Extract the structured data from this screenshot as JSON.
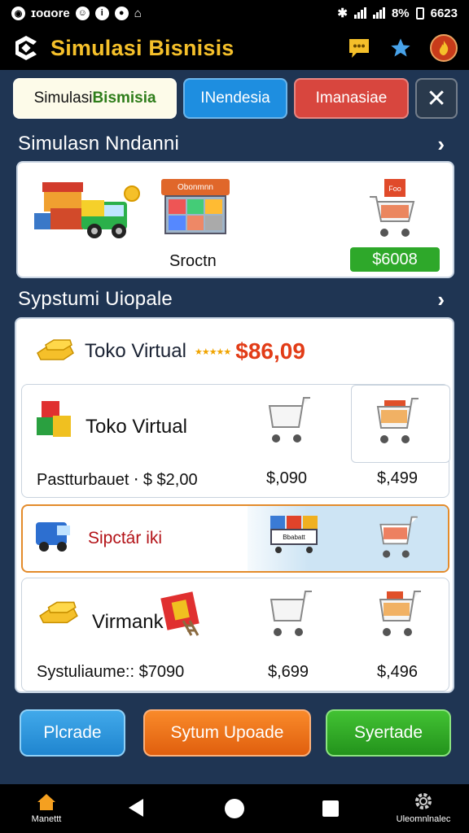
{
  "status_bar": {
    "carrier": "ɪoɑore",
    "battery": "8%",
    "time": "6623"
  },
  "app": {
    "title": "Simulasi Bisnisis"
  },
  "tabs": [
    {
      "label_a": "Simulasi ",
      "label_b": "Bismisia"
    },
    {
      "label": "INendesia"
    },
    {
      "label": "Imanasiae"
    },
    {
      "label": "✕"
    }
  ],
  "section1": {
    "title": "Simulasn Nndanni",
    "chevron": "›"
  },
  "card1": {
    "shop_sign": "Obonmnn",
    "cart_sign": "Foo",
    "label": "Sroctn",
    "price": "$6008"
  },
  "section2": {
    "title": "Sypstumi Uiopale",
    "chevron": "›"
  },
  "panel": {
    "header": {
      "name": "Toko Virtual",
      "stars": "★★★★★",
      "amount": "$86,09"
    },
    "row_a": {
      "title": "Toko Virtual",
      "footer": "Pastturbauet ⋅ $ $2,00",
      "price1": "$,090",
      "price2": "$,499"
    },
    "row_b": {
      "title": "Sipctár iki",
      "store_sign": "Bbabatt"
    },
    "row_c": {
      "title": "Virmank",
      "footer": "Systuliaume:: $7090",
      "price1": "$,699",
      "price2": "$,496"
    }
  },
  "buttons": {
    "blue": "Plcrade",
    "orange": "Sytum Upoade",
    "green": "Syertade"
  },
  "navbar": {
    "home": "Manettt",
    "settings": "Uleomnlnalec"
  }
}
